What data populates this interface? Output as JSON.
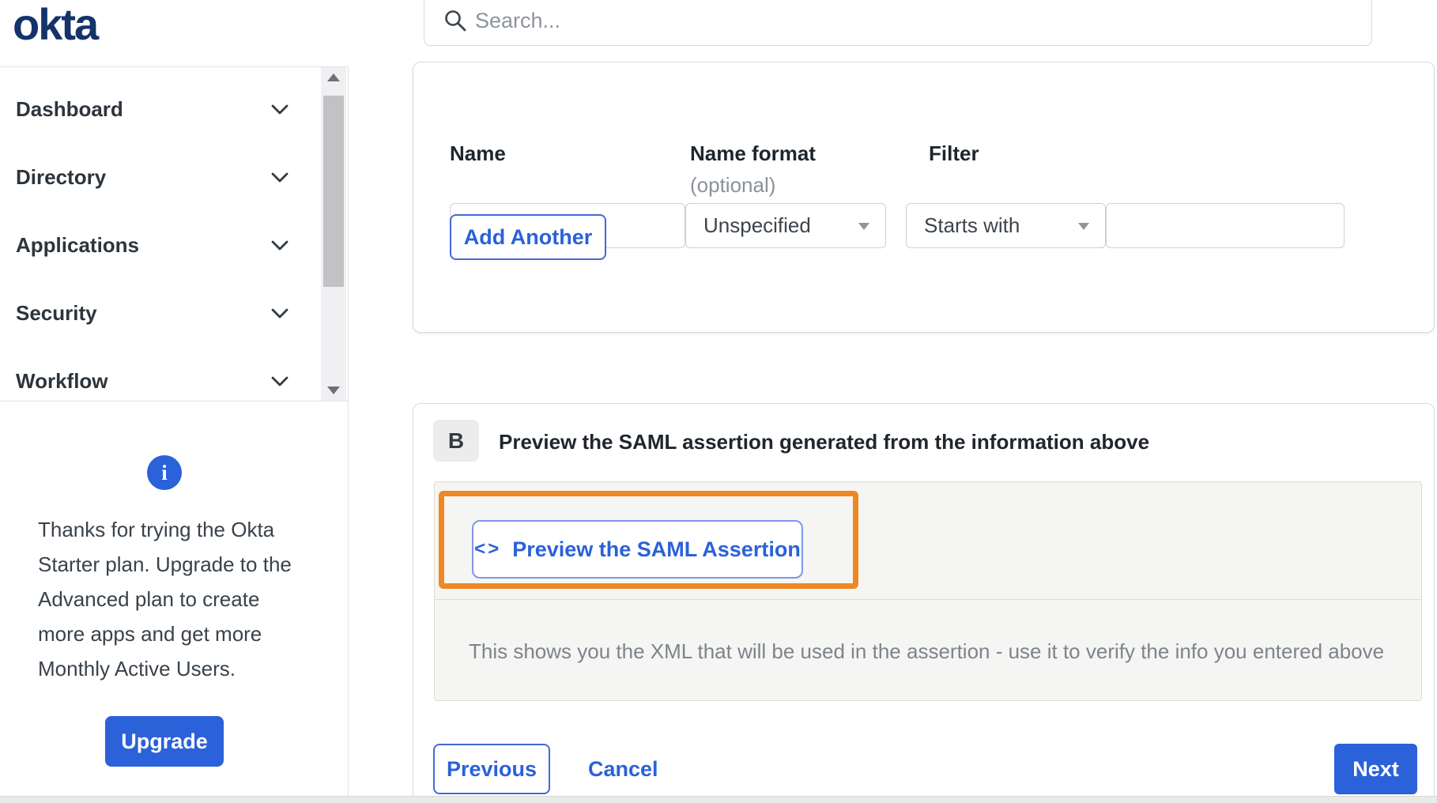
{
  "window": {
    "brand": "okta"
  },
  "search": {
    "placeholder": "Search...",
    "value": ""
  },
  "sidebar": {
    "items": [
      {
        "label": "Dashboard"
      },
      {
        "label": "Directory"
      },
      {
        "label": "Applications"
      },
      {
        "label": "Security"
      },
      {
        "label": "Workflow"
      }
    ],
    "upsell": {
      "message": "Thanks for trying the Okta Starter plan. Upgrade to the Advanced plan to create more apps and get more Monthly Active Users.",
      "button_label": "Upgrade"
    }
  },
  "attribute_form": {
    "headers": {
      "name": "Name",
      "name_format": "Name format",
      "name_format_note": "(optional)",
      "filter": "Filter"
    },
    "name_value": "",
    "name_format_selected": "Unspecified",
    "filter_operator_selected": "Starts with",
    "filter_value": "",
    "add_another_label": "Add Another"
  },
  "preview_section": {
    "badge": "B",
    "title": "Preview the SAML assertion generated from the information above",
    "preview_button": {
      "icon": "<>",
      "label": "Preview the SAML Assertion"
    },
    "description": "This shows you the XML that will be used in the assertion - use it to verify the info you entered above"
  },
  "footer": {
    "previous": "Previous",
    "cancel": "Cancel",
    "next": "Next"
  },
  "colors": {
    "accent_blue": "#2b61d9",
    "logo_navy": "#14336b",
    "annotation_orange": "#ee8822",
    "panel_gray": "#f5f5f3"
  }
}
